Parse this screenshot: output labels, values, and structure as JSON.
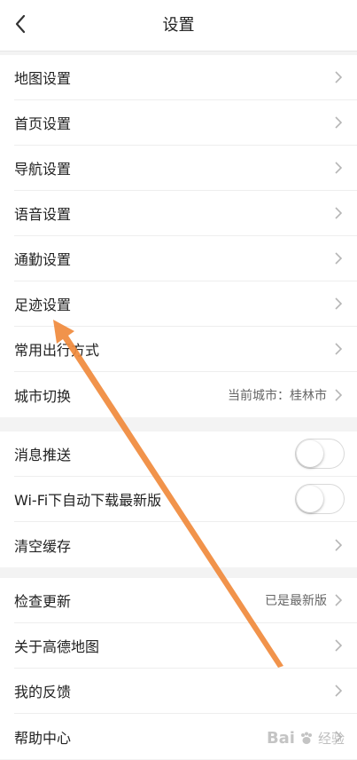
{
  "header": {
    "title": "设置"
  },
  "group1": {
    "items": [
      {
        "label": "地图设置"
      },
      {
        "label": "首页设置"
      },
      {
        "label": "导航设置"
      },
      {
        "label": "语音设置"
      },
      {
        "label": "通勤设置"
      },
      {
        "label": "足迹设置"
      },
      {
        "label": "常用出行方式"
      },
      {
        "label": "城市切换",
        "value": "当前城市：桂林市"
      }
    ]
  },
  "group2": {
    "items": [
      {
        "label": "消息推送",
        "toggle": false
      },
      {
        "label": "Wi-Fi下自动下载最新版",
        "toggle": false
      },
      {
        "label": "清空缓存"
      }
    ]
  },
  "group3": {
    "items": [
      {
        "label": "检查更新",
        "value": "已是最新版"
      },
      {
        "label": "关于高德地图"
      },
      {
        "label": "我的反馈"
      },
      {
        "label": "帮助中心"
      }
    ]
  },
  "watermark": {
    "brand": "Bai",
    "sub": "经验"
  },
  "colors": {
    "annotation_arrow": "#f08a3c",
    "separator": "#f3f3f3",
    "row_bg": "#ffffff"
  }
}
